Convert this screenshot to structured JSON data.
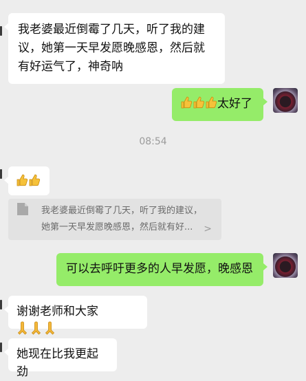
{
  "messages": {
    "m1": "我老婆最近倒霉了几天，听了我的建议，她第一天早发愿晚感恩，然后就有好运气了，神奇呐",
    "m2_text": "太好了",
    "m2_emoji": "thumbs-up-icon",
    "timestamp": "08:54",
    "m3_emoji": "thumbs-up-icon",
    "quote": "我老婆最近倒霉了几天，听了我的建议，她第一天早发愿晚感恩，然后就有好...",
    "quote_chevron": ">",
    "m4": "可以去呼吁更多的人早发愿，晚感恩",
    "m5_text": "谢谢老师和大家",
    "m5_emoji": "folded-hands-icon",
    "m6": "她现在比我更起劲"
  },
  "colors": {
    "background": "#ededed",
    "incoming_bubble": "#ffffff",
    "outgoing_bubble": "#95ec69",
    "quote_bg": "#e2e2e2"
  }
}
